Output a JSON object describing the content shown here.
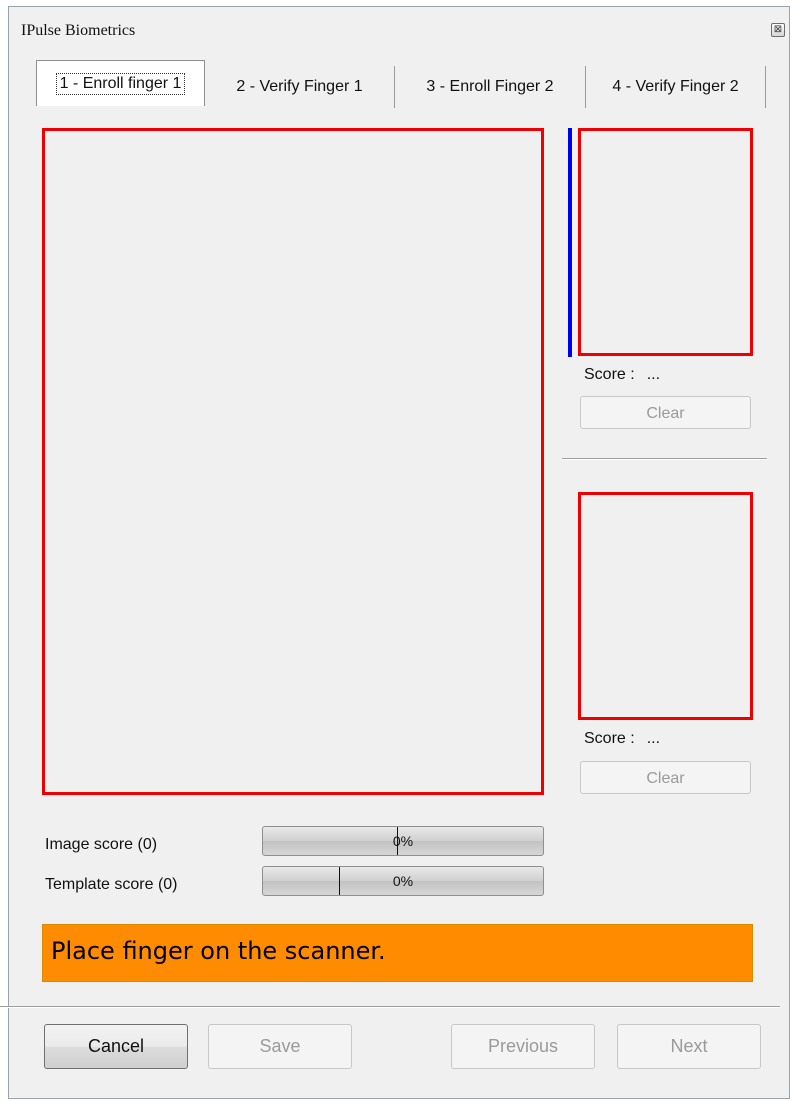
{
  "window": {
    "title": "IPulse Biometrics",
    "close_glyph": "⊠"
  },
  "tabs": [
    {
      "label": "1 - Enroll finger 1",
      "active": true
    },
    {
      "label": "2 - Verify Finger 1",
      "active": false
    },
    {
      "label": "3 - Enroll Finger 2",
      "active": false
    },
    {
      "label": "4 - Verify Finger 2",
      "active": false
    }
  ],
  "side_panels": [
    {
      "score_label": "Score :",
      "score_value": "...",
      "clear_label": "Clear"
    },
    {
      "score_label": "Score :",
      "score_value": "...",
      "clear_label": "Clear"
    }
  ],
  "scores": {
    "image": {
      "label": "Image score (0)",
      "percent_text": "0%",
      "fill_fraction": 0,
      "threshold_fraction": 0.48
    },
    "template": {
      "label": "Template score (0)",
      "percent_text": "0%",
      "fill_fraction": 0,
      "threshold_fraction": 0.27
    }
  },
  "status": {
    "message": "Place finger on the scanner.",
    "color": "#ff8c00"
  },
  "buttons": {
    "cancel": "Cancel",
    "save": "Save",
    "previous": "Previous",
    "next": "Next"
  },
  "colors": {
    "frame_border": "#ee0000",
    "quality_bar": "#0000ee"
  }
}
